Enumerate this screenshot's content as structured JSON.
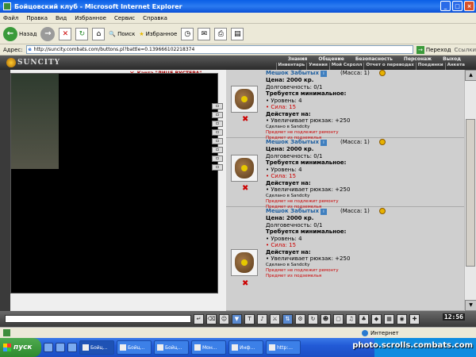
{
  "window": {
    "title": "Бойцовский клуб - Microsoft Internet Explorer"
  },
  "menu": [
    "Файл",
    "Правка",
    "Вид",
    "Избранное",
    "Сервис",
    "Справка"
  ],
  "toolbar": {
    "back": "Назад",
    "search": "Поиск",
    "favorites": "Избранное"
  },
  "address": {
    "label": "Адрес:",
    "url": "http://suncity.combats.com/buttons.pl?battle=0.139666102218374",
    "go": "Переход",
    "links": "Ссылки"
  },
  "game": {
    "logo": "SUNCITY",
    "nav_top": [
      "Знания",
      "Общение",
      "Безопасность",
      "Персонаж",
      "Выход"
    ],
    "nav_sub": [
      "Инвентарь",
      "Умения",
      "Мой Скролл",
      "Отчет о переводах",
      "Поединки",
      "Анкета"
    ],
    "char_title": "Карта \"ЛИЦЕ ВУСТЕРА\""
  },
  "items": [
    {
      "name": "Мешок Забытых",
      "mass": "(Масса: 1)",
      "price": "Цена: 2000 кр.",
      "durability": "Долговечность: 0/1",
      "req_title": "Требуется минимальное:",
      "req_level": "• Уровень: 4",
      "req_strength": "• Сила: 15",
      "acts_title": "Действует на:",
      "effect": "• Увеличивает рюкзак: +250",
      "made": "Сделано в Sandcity",
      "note1": "Предмет не подлежит ремонту",
      "note2": "Предмет из подземелья"
    },
    {
      "name": "Мешок Забытых",
      "mass": "(Масса: 1)",
      "price": "Цена: 2000 кр.",
      "durability": "Долговечность: 0/1",
      "req_title": "Требуется минимальное:",
      "req_level": "• Уровень: 4",
      "req_strength": "• Сила: 15",
      "acts_title": "Действует на:",
      "effect": "• Увеличивает рюкзак: +250",
      "made": "Сделано в Sandcity",
      "note1": "Предмет не подлежит ремонту",
      "note2": "Предмет из подземелья"
    },
    {
      "name": "Мешок Забытых",
      "mass": "(Масса: 1)",
      "price": "Цена: 2000 кр.",
      "durability": "Долговечность: 0/1",
      "req_title": "Требуется минимальное:",
      "req_level": "• Уровень: 4",
      "req_strength": "• Сила: 15",
      "acts_title": "Действует на:",
      "effect": "• Увеличивает рюкзак: +250",
      "made": "Сделано в Sandcity",
      "note1": "Предмет не подлежит ремонту",
      "note2": "Предмет из подземелья"
    }
  ],
  "clock": "12:56",
  "status": {
    "zone": "Интернет"
  },
  "taskbar": {
    "start": "пуск",
    "tasks": [
      "Бойц...",
      "Бойц...",
      "Бойц...",
      "Мон...",
      "Инф...",
      "http:..."
    ],
    "watermark": "photo.scrolls.combats.com"
  }
}
